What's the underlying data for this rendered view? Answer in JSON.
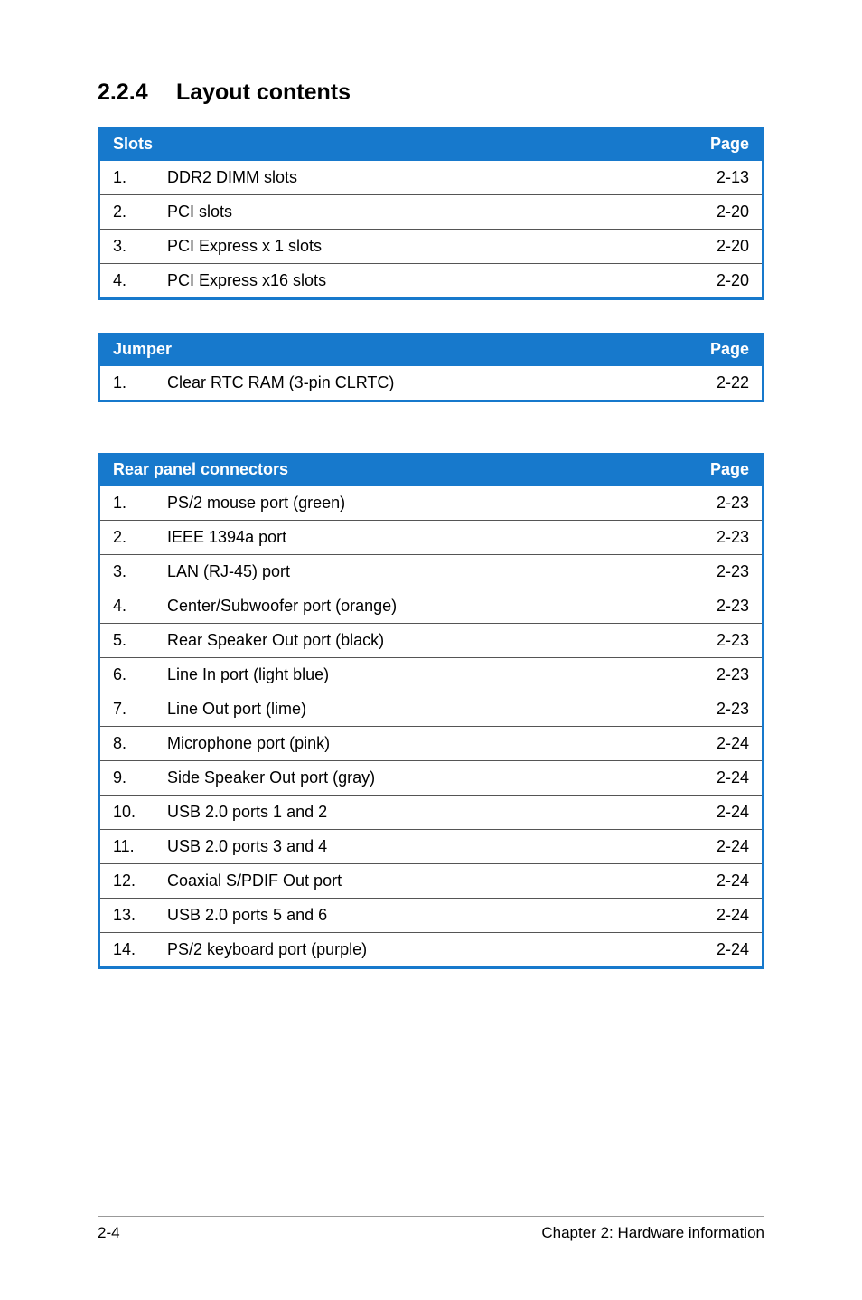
{
  "heading": {
    "number": "2.2.4",
    "title": "Layout contents"
  },
  "slots_table": {
    "header": {
      "title": "Slots",
      "page": "Page"
    },
    "rows": [
      {
        "n": "1.",
        "desc": "DDR2 DIMM slots",
        "page": "2-13"
      },
      {
        "n": "2.",
        "desc": "PCI slots",
        "page": "2-20"
      },
      {
        "n": "3.",
        "desc": "PCI Express x 1 slots",
        "page": "2-20"
      },
      {
        "n": "4.",
        "desc": "PCI Express x16 slots",
        "page": "2-20"
      }
    ]
  },
  "jumper_table": {
    "header": {
      "title": "Jumper",
      "page": "Page"
    },
    "rows": [
      {
        "n": "1.",
        "desc": "Clear RTC RAM (3-pin CLRTC)",
        "page": "2-22"
      }
    ]
  },
  "connectors_table": {
    "header": {
      "title": "Rear panel connectors",
      "page": "Page"
    },
    "rows": [
      {
        "n": "1.",
        "desc": "PS/2 mouse port (green)",
        "page": "2-23"
      },
      {
        "n": "2.",
        "desc": "IEEE 1394a port",
        "page": "2-23"
      },
      {
        "n": "3.",
        "desc": "LAN (RJ-45) port",
        "page": "2-23"
      },
      {
        "n": "4.",
        "desc": "Center/Subwoofer port (orange)",
        "page": "2-23"
      },
      {
        "n": "5.",
        "desc": "Rear Speaker Out port (black)",
        "page": "2-23"
      },
      {
        "n": "6.",
        "desc": "Line In port (light blue)",
        "page": "2-23"
      },
      {
        "n": "7.",
        "desc": "Line Out port (lime)",
        "page": "2-23"
      },
      {
        "n": "8.",
        "desc": "Microphone port (pink)",
        "page": "2-24"
      },
      {
        "n": "9.",
        "desc": "Side Speaker Out port (gray)",
        "page": "2-24"
      },
      {
        "n": "10.",
        "desc": "USB 2.0 ports 1 and 2",
        "page": "2-24"
      },
      {
        "n": "11.",
        "desc": "USB 2.0 ports 3 and 4",
        "page": "2-24"
      },
      {
        "n": "12.",
        "desc": "Coaxial S/PDIF Out port",
        "page": "2-24"
      },
      {
        "n": "13.",
        "desc": "USB 2.0 ports 5 and 6",
        "page": "2-24"
      },
      {
        "n": "14.",
        "desc": "PS/2 keyboard port (purple)",
        "page": "2-24"
      }
    ]
  },
  "footer": {
    "left": "2-4",
    "right": "Chapter 2: Hardware information"
  }
}
